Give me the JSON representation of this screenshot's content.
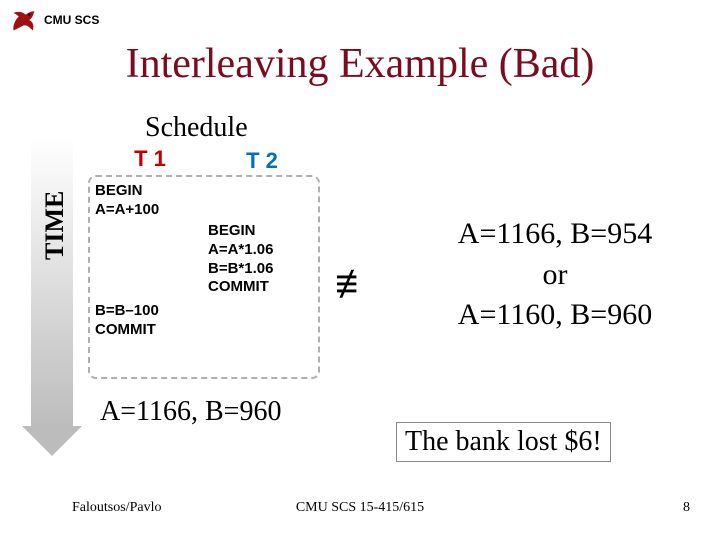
{
  "header": {
    "cmu": "CMU SCS"
  },
  "title": "Interleaving Example (Bad)",
  "schedule_label": "Schedule",
  "time_label": "TIME",
  "columns": {
    "t1": "T 1",
    "t2": "T 2"
  },
  "ops": {
    "t1a": "BEGIN\nA=A+100",
    "t2": "BEGIN\nA=A*1.06\nB=B*1.06\nCOMMIT",
    "t1b": "B=B–100\nCOMMIT"
  },
  "result_bad": "A=1166, B=960",
  "neq": "≢",
  "serial": {
    "line1": "A=1166, B=954",
    "line2": "or",
    "line3": "A=1160, B=960"
  },
  "banklost": "The bank lost $6!",
  "footer": {
    "left": "Faloutsos/Pavlo",
    "center": "CMU SCS 15-415/615",
    "right": "8"
  }
}
